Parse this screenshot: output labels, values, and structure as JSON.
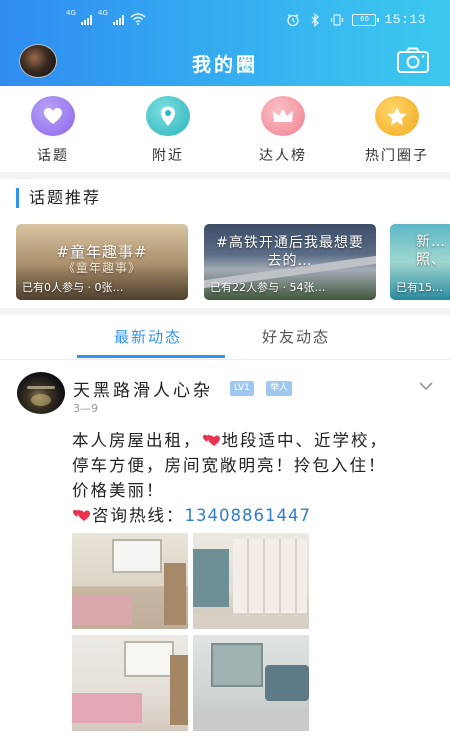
{
  "status_bar": {
    "network": [
      "4G",
      "4G"
    ],
    "battery": "66",
    "time": "15:13"
  },
  "header": {
    "title": "我的圈"
  },
  "menu": [
    {
      "label": "话题",
      "icon": "heart-icon",
      "color": "#9b7cf0"
    },
    {
      "label": "附近",
      "icon": "location-pin-icon",
      "color": "#34c0c8"
    },
    {
      "label": "达人榜",
      "icon": "crown-icon",
      "color": "#f28f9a"
    },
    {
      "label": "热门圈子",
      "icon": "star-icon",
      "color": "#f7b830"
    }
  ],
  "topics": {
    "title": "话题推荐",
    "cards": [
      {
        "name": "#童年趣事#",
        "subtitle": "《童年趣事》",
        "meta": "已有0人参与 · 0张…"
      },
      {
        "name": "#高铁开通后我最想要去的…",
        "meta": "已有22人参与 · 54张…"
      },
      {
        "name": "新…",
        "subtitle": "照、",
        "meta": "已有15…"
      }
    ]
  },
  "tabs": [
    {
      "label": "最新动态",
      "active": true
    },
    {
      "label": "好友动态",
      "active": false
    }
  ],
  "post": {
    "username": "天黑路滑人心杂",
    "level": "LV1",
    "tag": "举人",
    "date": "3—9",
    "text_line1": "本人房屋出租，",
    "text_line1b": "地段适中、近学校，",
    "text_line2": "停车方便，房间宽敞明亮！拎包入住！",
    "text_line3": "价格美丽！",
    "text_line4": "咨询热线：",
    "phone": "13408861447"
  },
  "colors": {
    "accent": "#2f95ee",
    "header_start": "#2f8cf2",
    "header_end": "#3cc9ee"
  }
}
